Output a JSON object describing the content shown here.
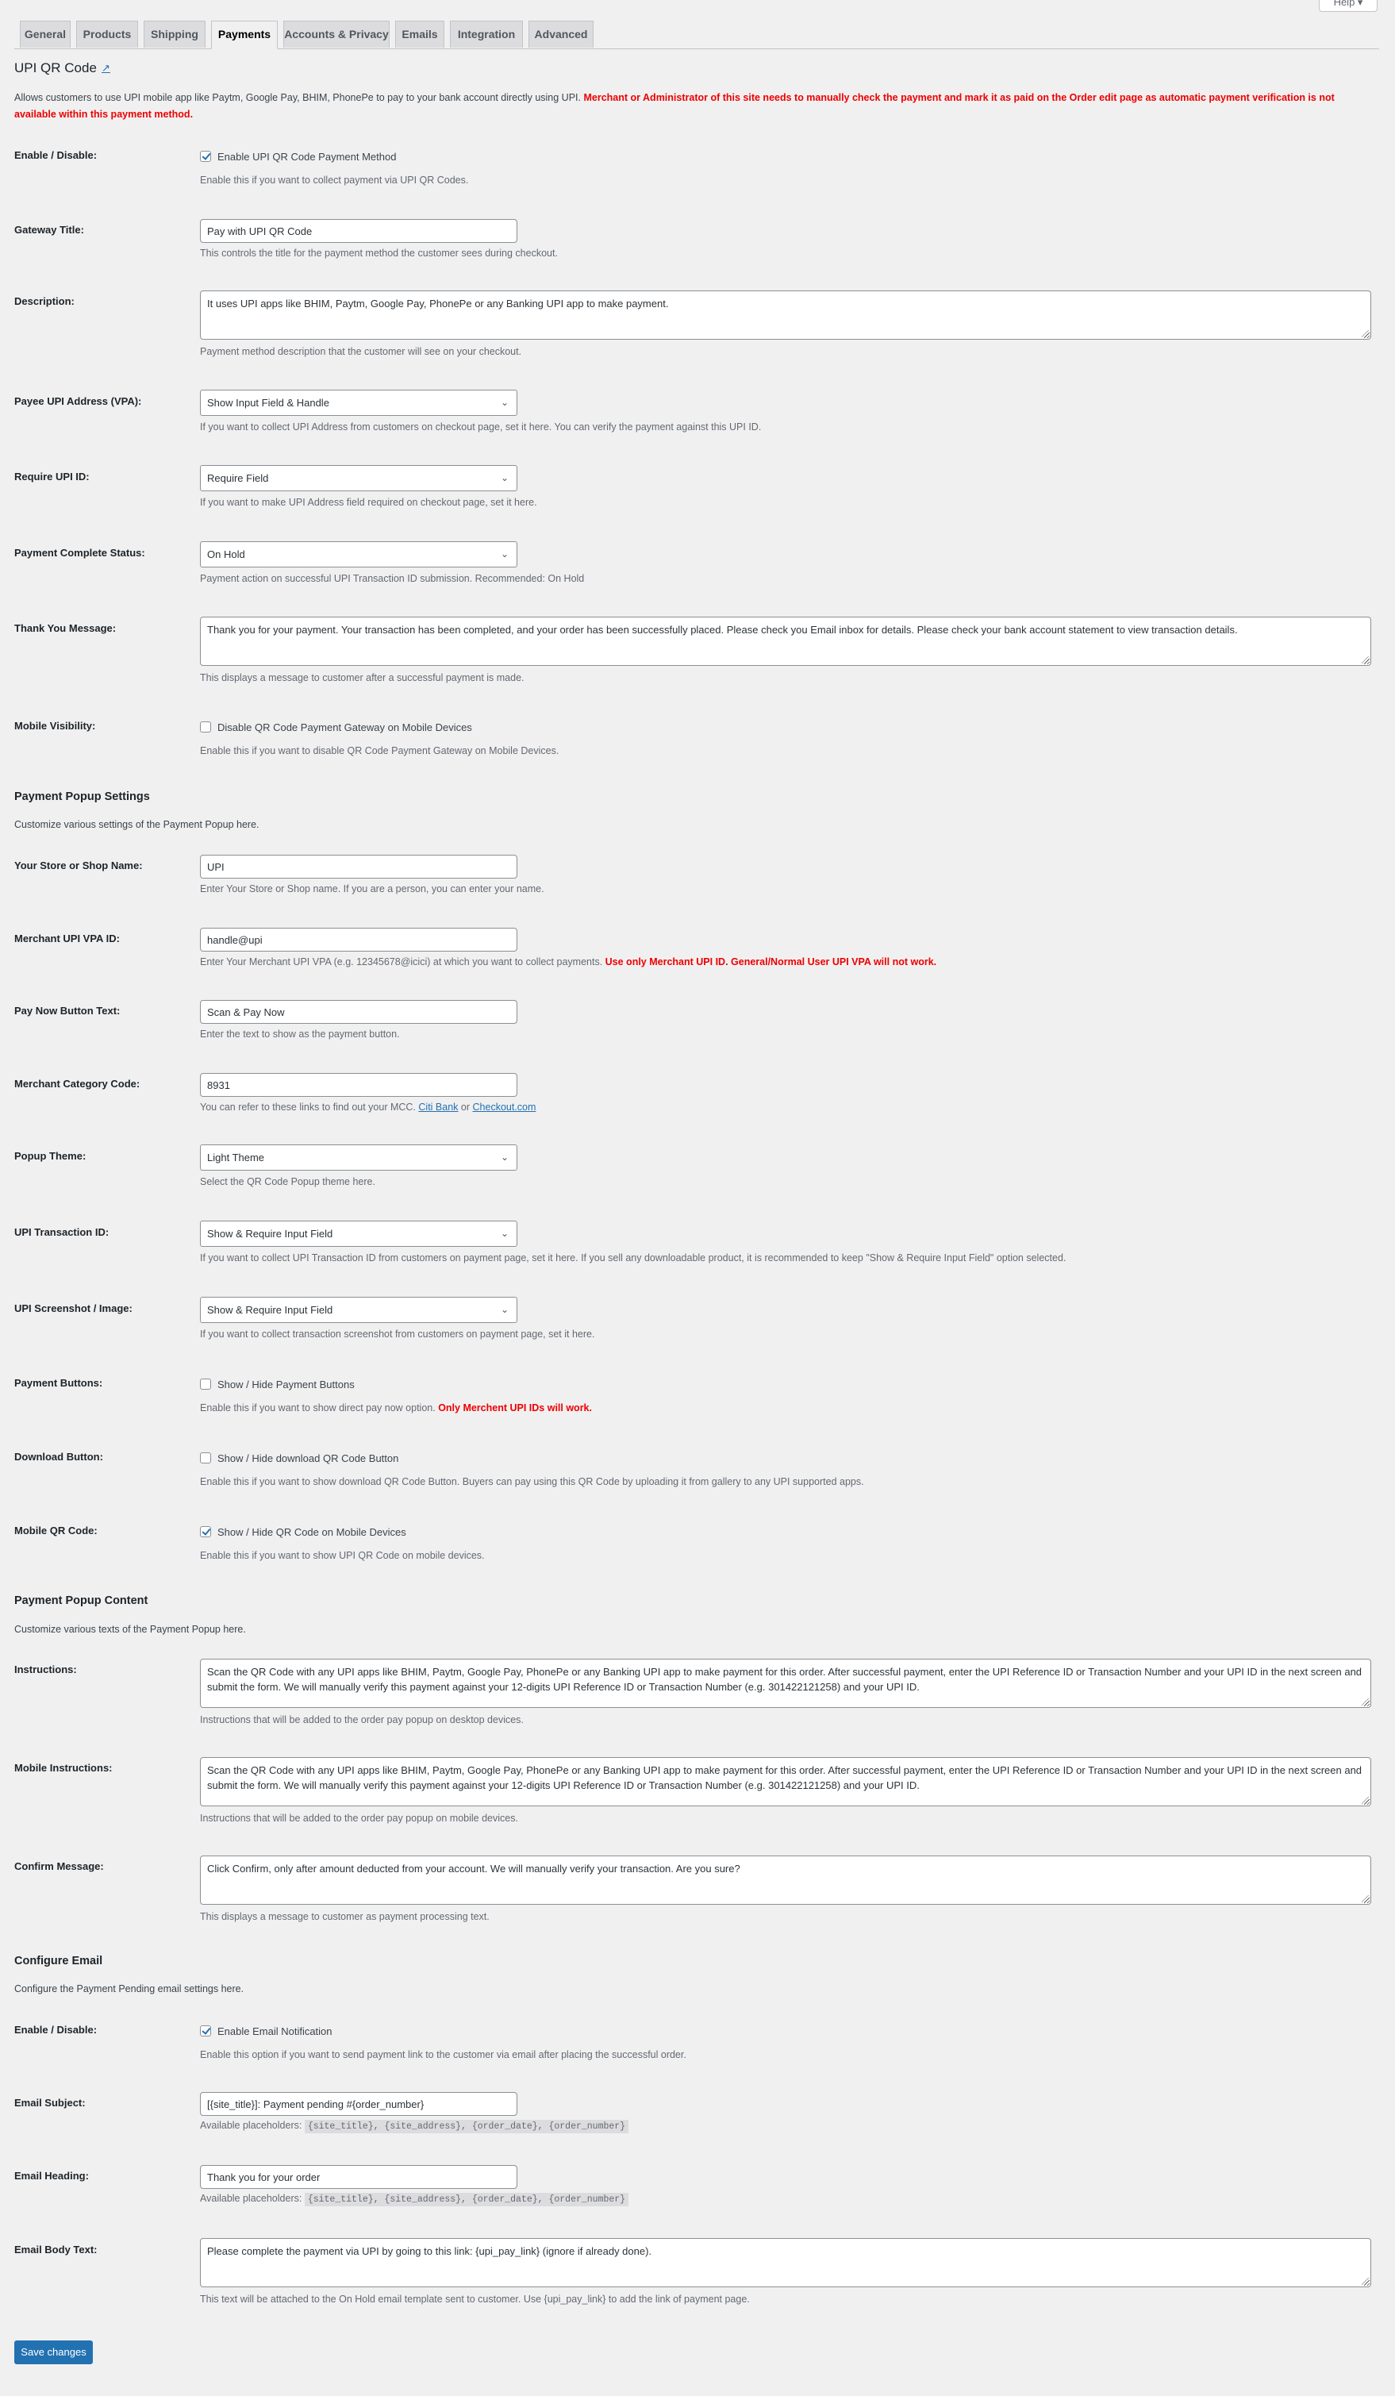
{
  "header": {
    "help_label": "Help ▾",
    "tabs": [
      {
        "label": "General",
        "active": false
      },
      {
        "label": "Products",
        "active": false
      },
      {
        "label": "Shipping",
        "active": false
      },
      {
        "label": "Payments",
        "active": true
      },
      {
        "label": "Accounts & Privacy",
        "active": false
      },
      {
        "label": "Emails",
        "active": false
      },
      {
        "label": "Integration",
        "active": false
      },
      {
        "label": "Advanced",
        "active": false
      }
    ]
  },
  "page": {
    "title": "UPI QR Code",
    "title_link_icon": "external-link-icon",
    "intro": "Allows customers to use UPI mobile app like Paytm, Google Pay, BHIM, PhonePe to pay to your bank account directly using UPI.",
    "intro_warning": "Merchant or Administrator of this site needs to manually check the payment and mark it as paid on the Order edit page as automatic payment verification is not available within this payment method."
  },
  "general": {
    "enable": {
      "label": "Enable / Disable:",
      "checkbox_label": "Enable UPI QR Code Payment Method",
      "checked": true,
      "desc": "Enable this if you want to collect payment via UPI QR Codes."
    },
    "gateway_title": {
      "label": "Gateway Title:",
      "value": "Pay with UPI QR Code",
      "desc": "This controls the title for the payment method the customer sees during checkout."
    },
    "description": {
      "label": "Description:",
      "value": "It uses UPI apps like BHIM, Paytm, Google Pay, PhonePe or any Banking UPI app to make payment.",
      "desc": "Payment method description that the customer will see on your checkout."
    },
    "payee_vpa": {
      "label": "Payee UPI Address (VPA):",
      "value": "Show Input Field & Handle",
      "desc": "If you want to collect UPI Address from customers on checkout page, set it here. You can verify the payment against this UPI ID."
    },
    "require_upi": {
      "label": "Require UPI ID:",
      "value": "Require Field",
      "desc": "If you want to make UPI Address field required on checkout page, set it here."
    },
    "complete_status": {
      "label": "Payment Complete Status:",
      "value": "On Hold",
      "desc": "Payment action on successful UPI Transaction ID submission. Recommended: On Hold"
    },
    "thank_you": {
      "label": "Thank You Message:",
      "value": "Thank you for your payment. Your transaction has been completed, and your order has been successfully placed. Please check you Email inbox for details. Please check your bank account statement to view transaction details.",
      "desc": "This displays a message to customer after a successful payment is made."
    },
    "mobile_visibility": {
      "label": "Mobile Visibility:",
      "checkbox_label": "Disable QR Code Payment Gateway on Mobile Devices",
      "checked": false,
      "desc": "Enable this if you want to disable QR Code Payment Gateway on Mobile Devices."
    }
  },
  "popup_settings": {
    "heading": "Payment Popup Settings",
    "desc": "Customize various settings of the Payment Popup here.",
    "store_name": {
      "label": "Your Store or Shop Name:",
      "value": "UPI",
      "desc": "Enter Your Store or Shop name. If you are a person, you can enter your name."
    },
    "merchant_vpa": {
      "label": "Merchant UPI VPA ID:",
      "value": "handle@upi",
      "desc": "Enter Your Merchant UPI VPA (e.g. 12345678@icici) at which you want to collect payments.",
      "desc_warning": "Use only Merchant UPI ID. General/Normal User UPI VPA will not work."
    },
    "pay_now_text": {
      "label": "Pay Now Button Text:",
      "value": "Scan & Pay Now",
      "desc": "Enter the text to show as the payment button."
    },
    "mcc": {
      "label": "Merchant Category Code:",
      "value": "8931",
      "desc": "You can refer to these links to find out your MCC.",
      "link1": "Citi Bank",
      "or": "or",
      "link2": "Checkout.com"
    },
    "theme": {
      "label": "Popup Theme:",
      "value": "Light Theme",
      "desc": "Select the QR Code Popup theme here."
    },
    "transaction_id": {
      "label": "UPI Transaction ID:",
      "value": "Show & Require Input Field",
      "desc": "If you want to collect UPI Transaction ID from customers on payment page, set it here. If you sell any downloadable product, it is recommended to keep \"Show & Require Input Field\" option selected."
    },
    "screenshot": {
      "label": "UPI Screenshot / Image:",
      "value": "Show & Require Input Field",
      "desc": "If you want to collect transaction screenshot from customers on payment page, set it here."
    },
    "payment_buttons": {
      "label": "Payment Buttons:",
      "checkbox_label": "Show / Hide Payment Buttons",
      "checked": false,
      "desc": "Enable this if you want to show direct pay now option.",
      "desc_warning": "Only Merchent UPI IDs will work."
    },
    "download_button": {
      "label": "Download Button:",
      "checkbox_label": "Show / Hide download QR Code Button",
      "checked": false,
      "desc": "Enable this if you want to show download QR Code Button. Buyers can pay using this QR Code by uploading it from gallery to any UPI supported apps."
    },
    "mobile_qr": {
      "label": "Mobile QR Code:",
      "checkbox_label": "Show / Hide QR Code on Mobile Devices",
      "checked": true,
      "desc": "Enable this if you want to show UPI QR Code on mobile devices."
    }
  },
  "popup_content": {
    "heading": "Payment Popup Content",
    "desc": "Customize various texts of the Payment Popup here.",
    "instructions": {
      "label": "Instructions:",
      "value": "Scan the QR Code with any UPI apps like BHIM, Paytm, Google Pay, PhonePe or any Banking UPI app to make payment for this order. After successful payment, enter the UPI Reference ID or Transaction Number and your UPI ID in the next screen and submit the form. We will manually verify this payment against your 12-digits UPI Reference ID or Transaction Number (e.g. 301422121258) and your UPI ID.",
      "desc": "Instructions that will be added to the order pay popup on desktop devices."
    },
    "mobile_instructions": {
      "label": "Mobile Instructions:",
      "value": "Scan the QR Code with any UPI apps like BHIM, Paytm, Google Pay, PhonePe or any Banking UPI app to make payment for this order. After successful payment, enter the UPI Reference ID or Transaction Number and your UPI ID in the next screen and submit the form. We will manually verify this payment against your 12-digits UPI Reference ID or Transaction Number (e.g. 301422121258) and your UPI ID.",
      "desc": "Instructions that will be added to the order pay popup on mobile devices."
    },
    "confirm": {
      "label": "Confirm Message:",
      "value": "Click Confirm, only after amount deducted from your account. We will manually verify your transaction. Are you sure?",
      "desc": "This displays a message to customer as payment processing text."
    }
  },
  "email": {
    "heading": "Configure Email",
    "desc": "Configure the Payment Pending email settings here.",
    "enable": {
      "label": "Enable / Disable:",
      "checkbox_label": "Enable Email Notification",
      "checked": true,
      "desc": "Enable this option if you want to send payment link to the customer via email after placing the successful order."
    },
    "subject": {
      "label": "Email Subject:",
      "value": "[{site_title}]: Payment pending #{order_number}",
      "desc": "Available placeholders:",
      "placeholders": "{site_title}, {site_address}, {order_date}, {order_number}"
    },
    "heading_field": {
      "label": "Email Heading:",
      "value": "Thank you for your order",
      "desc": "Available placeholders:",
      "placeholders": "{site_title}, {site_address}, {order_date}, {order_number}"
    },
    "body": {
      "label": "Email Body Text:",
      "value": "Please complete the payment via UPI by going to this link: {upi_pay_link} (ignore if already done).",
      "desc": "This text will be attached to the On Hold email template sent to customer. Use {upi_pay_link} to add the link of payment page."
    }
  },
  "footer": {
    "save_label": "Save changes"
  }
}
